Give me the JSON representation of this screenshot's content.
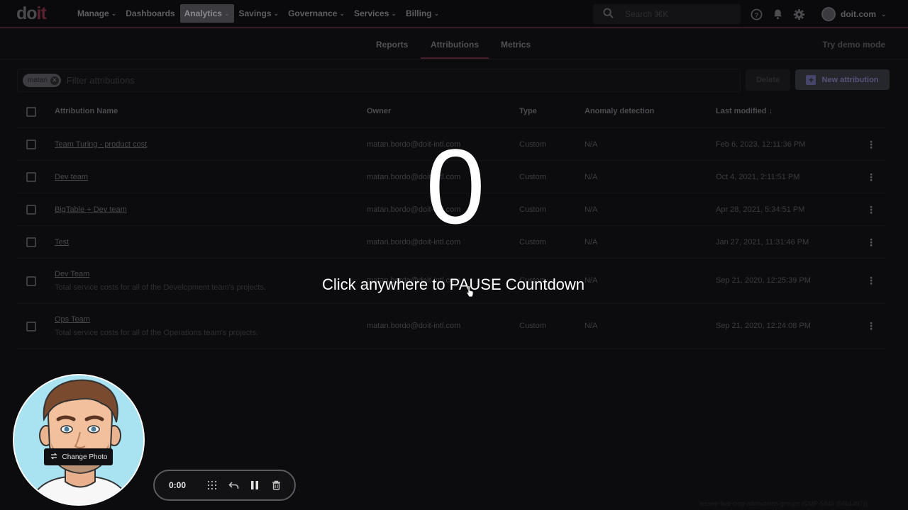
{
  "brand": {
    "logo_do": "do",
    "logo_it": "it"
  },
  "nav": {
    "items": [
      {
        "label": "Manage",
        "chevron": true
      },
      {
        "label": "Dashboards",
        "chevron": false
      },
      {
        "label": "Analytics",
        "chevron": true,
        "active": true
      },
      {
        "label": "Savings",
        "chevron": true
      },
      {
        "label": "Governance",
        "chevron": true
      },
      {
        "label": "Services",
        "chevron": true
      },
      {
        "label": "Billing",
        "chevron": true
      }
    ],
    "search_placeholder": "Search ⌘K",
    "icons": [
      "help-icon",
      "bell-icon",
      "gear-icon"
    ],
    "account_label": "doit.com"
  },
  "subtabs": {
    "items": [
      "Reports",
      "Attributions",
      "Metrics"
    ],
    "active": "Attributions",
    "demo_link": "Try demo mode"
  },
  "filter": {
    "chip_label": "matan",
    "placeholder": "Filter attributions"
  },
  "actions": {
    "delete_label": "Delete",
    "new_label": "New attribution"
  },
  "table": {
    "headers": {
      "name": "Attribution Name",
      "owner": "Owner",
      "type": "Type",
      "anomaly": "Anomaly detection",
      "modified": "Last modified"
    },
    "rows": [
      {
        "name": "Team Turing - product cost",
        "desc": "",
        "owner": "matan.bordo@doit-intl.com",
        "type": "Custom",
        "anomaly": "N/A",
        "modified": "Feb 6, 2023, 12:11:36 PM"
      },
      {
        "name": "Dev team",
        "desc": "",
        "owner": "matan.bordo@doit-intl.com",
        "type": "Custom",
        "anomaly": "N/A",
        "modified": "Oct 4, 2021, 2:11:51 PM"
      },
      {
        "name": "BigTable + Dev team",
        "desc": "",
        "owner": "matan.bordo@doit-intl.com",
        "type": "Custom",
        "anomaly": "N/A",
        "modified": "Apr 28, 2021, 5:34:51 PM"
      },
      {
        "name": "Test",
        "desc": "",
        "owner": "matan.bordo@doit-intl.com",
        "type": "Custom",
        "anomaly": "N/A",
        "modified": "Jan 27, 2021, 11:31:46 PM"
      },
      {
        "name": "Dev Team",
        "desc": "Total service costs for all of the Development team's projects.",
        "owner": "matan.bordo@doit-intl.com",
        "type": "Custom",
        "anomaly": "N/A",
        "modified": "Sep 21, 2020, 12:25:39 PM"
      },
      {
        "name": "Ops Team",
        "desc": "Total service costs for all of the Operations team's projects.",
        "owner": "matan.bordo@doit-intl.com",
        "type": "Custom",
        "anomaly": "N/A",
        "modified": "Sep 21, 2020, 12:24:08 PM"
      }
    ]
  },
  "overlay": {
    "countdown": "0",
    "message": "Click anywhere to PAUSE Countdown"
  },
  "webcam": {
    "change_photo_label": "Change Photo"
  },
  "recorder": {
    "time": "0:00",
    "buttons": [
      "grid-icon",
      "undo-icon",
      "pause-icon",
      "trash-icon"
    ]
  },
  "footer_note": "lessee-feat-cmp-attributions-groups (CMP-5849 (56b1497))"
}
